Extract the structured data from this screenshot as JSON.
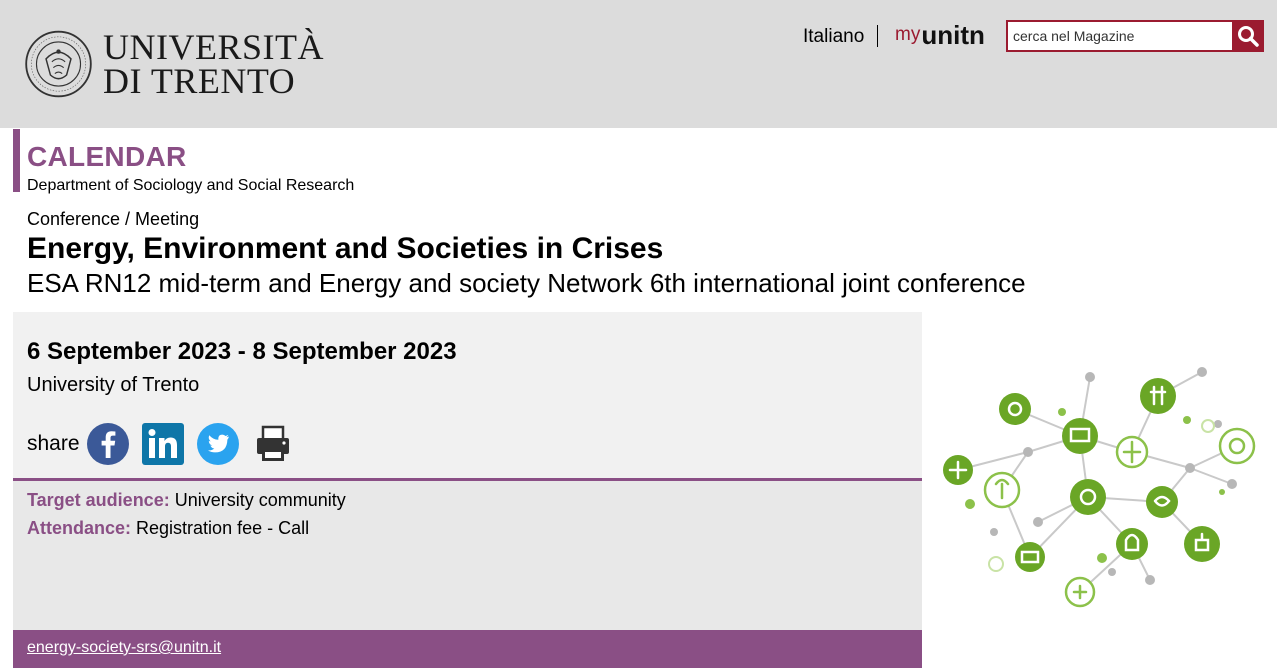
{
  "header": {
    "logo_line1": "UNIVERSITÀ",
    "logo_line2": "DI TRENTO",
    "language_link": "Italiano",
    "myunitn_prefix": "my",
    "myunitn_main": "unitn",
    "search_placeholder": "cerca nel Magazine"
  },
  "page": {
    "section_title": "CALENDAR",
    "department": "Department of Sociology and Social Research"
  },
  "event": {
    "type": "Conference / Meeting",
    "title": "Energy, Environment and Societies in Crises",
    "subtitle": "ESA RN12 mid-term and Energy and society Network 6th international joint conference",
    "dates": "6 September 2023 - 8 September 2023",
    "venue": "University of Trento",
    "share_label": "share",
    "share_targets": [
      "facebook-icon",
      "linkedin-icon",
      "twitter-icon",
      "print-icon"
    ],
    "target_audience_label": "Target audience:",
    "target_audience_value": "University community",
    "attendance_label": "Attendance:",
    "attendance_value": "Registration fee - Call",
    "contact_email": "energy-society-srs@unitn.it"
  },
  "colors": {
    "accent_purple": "#8a4f85",
    "brand_red": "#9b1b30",
    "header_bg": "#dcdcdc",
    "facebook": "#3b5998",
    "linkedin": "#0e76a8",
    "twitter": "#2aa3ef",
    "illustration_green": "#6aa626"
  }
}
